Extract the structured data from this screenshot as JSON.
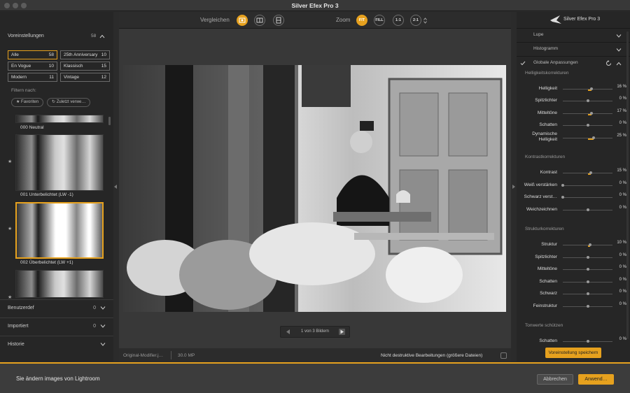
{
  "window": {
    "title": "Silver Efex Pro 3"
  },
  "left": {
    "presets_label": "Voreinstellungen",
    "presets_count": "58",
    "categories": [
      {
        "label": "Alle",
        "count": "58",
        "selected": true
      },
      {
        "label": "25th Anniversary",
        "count": "10",
        "selected": false
      },
      {
        "label": "En Vogue",
        "count": "10",
        "selected": false
      },
      {
        "label": "Klassisch",
        "count": "15",
        "selected": false
      },
      {
        "label": "Modern",
        "count": "11",
        "selected": false
      },
      {
        "label": "Vintage",
        "count": "12",
        "selected": false
      }
    ],
    "filter_label": "Filtern nach:",
    "chip_favorites": "★ Favoriten",
    "chip_recent": "↻ Zuletzt verwe…",
    "thumbs": [
      {
        "label": "000 Neutral"
      },
      {
        "label": "001 Unterbelichtet (LW -1)"
      },
      {
        "label": "002 Überbelichtet (LW +1)"
      }
    ],
    "sections": [
      {
        "label": "Benutzerdef",
        "count": "0"
      },
      {
        "label": "Importiert",
        "count": "0"
      },
      {
        "label": "Historie",
        "count": ""
      }
    ]
  },
  "center": {
    "compare_label": "Vergleichen",
    "zoom_label": "Zoom",
    "zoom_fit": "FIT",
    "zoom_fill": "FILL",
    "zoom_11": "1:1",
    "zoom_21": "2:1",
    "pager_text": "1 von 3 Bildern",
    "status_file": "Original-Modifier.j…",
    "status_mp": "30.0 MP",
    "status_nondestructive": "Nicht destruktive Bearbeitungen (größere Dateien)"
  },
  "right": {
    "header": "Silver Efex Pro 3",
    "lupe": "Lupe",
    "histogramm": "Histogramm",
    "global": "Globale Anpassungen",
    "groups": {
      "brightness": "Helligkeitskorrekturen",
      "contrast": "Kontrastkorrekturen",
      "structure": "Strukturkorrekturen",
      "tonal": "Tonwerte schützen"
    },
    "sliders": {
      "helligkeit": {
        "label": "Helligkeit",
        "value": "16 %",
        "level": 0.58
      },
      "spitz1": {
        "label": "Spitzlichter",
        "value": "0 %",
        "level": 0.5
      },
      "mittel1": {
        "label": "Mitteltöne",
        "value": "17 %",
        "level": 0.58
      },
      "schatten1": {
        "label": "Schatten",
        "value": "0 %",
        "level": 0.5
      },
      "dyn": {
        "label": "Dynamische Helligkeit",
        "value": "25 %",
        "level": 0.62
      },
      "kontrast": {
        "label": "Kontrast",
        "value": "15 %",
        "level": 0.57
      },
      "weiss": {
        "label": "Weiß verstärken",
        "value": "0 %",
        "level": 0.0
      },
      "schwarz": {
        "label": "Schwarz verst…",
        "value": "0 %",
        "level": 0.0
      },
      "weich": {
        "label": "Weichzeichnen",
        "value": "0 %",
        "level": 0.5
      },
      "struktur": {
        "label": "Struktur",
        "value": "10 %",
        "level": 0.55
      },
      "spitz2": {
        "label": "Spitzlichter",
        "value": "0 %",
        "level": 0.5
      },
      "mittel2": {
        "label": "Mitteltöne",
        "value": "0 %",
        "level": 0.5
      },
      "schatten2": {
        "label": "Schatten",
        "value": "0 %",
        "level": 0.5
      },
      "schwarz2": {
        "label": "Schwarz",
        "value": "0 %",
        "level": 0.5
      },
      "fein": {
        "label": "Feinstruktur",
        "value": "0 %",
        "level": 0.5
      },
      "schatten3": {
        "label": "Schatten",
        "value": "0 %",
        "level": 0.5
      }
    },
    "save_preset": "Voreinstellung speichern"
  },
  "bottom": {
    "message": "Sie ändern images von Lightroom",
    "cancel": "Abbrechen",
    "apply": "Anwend…"
  },
  "colors": {
    "accent": "#e6a11e"
  }
}
